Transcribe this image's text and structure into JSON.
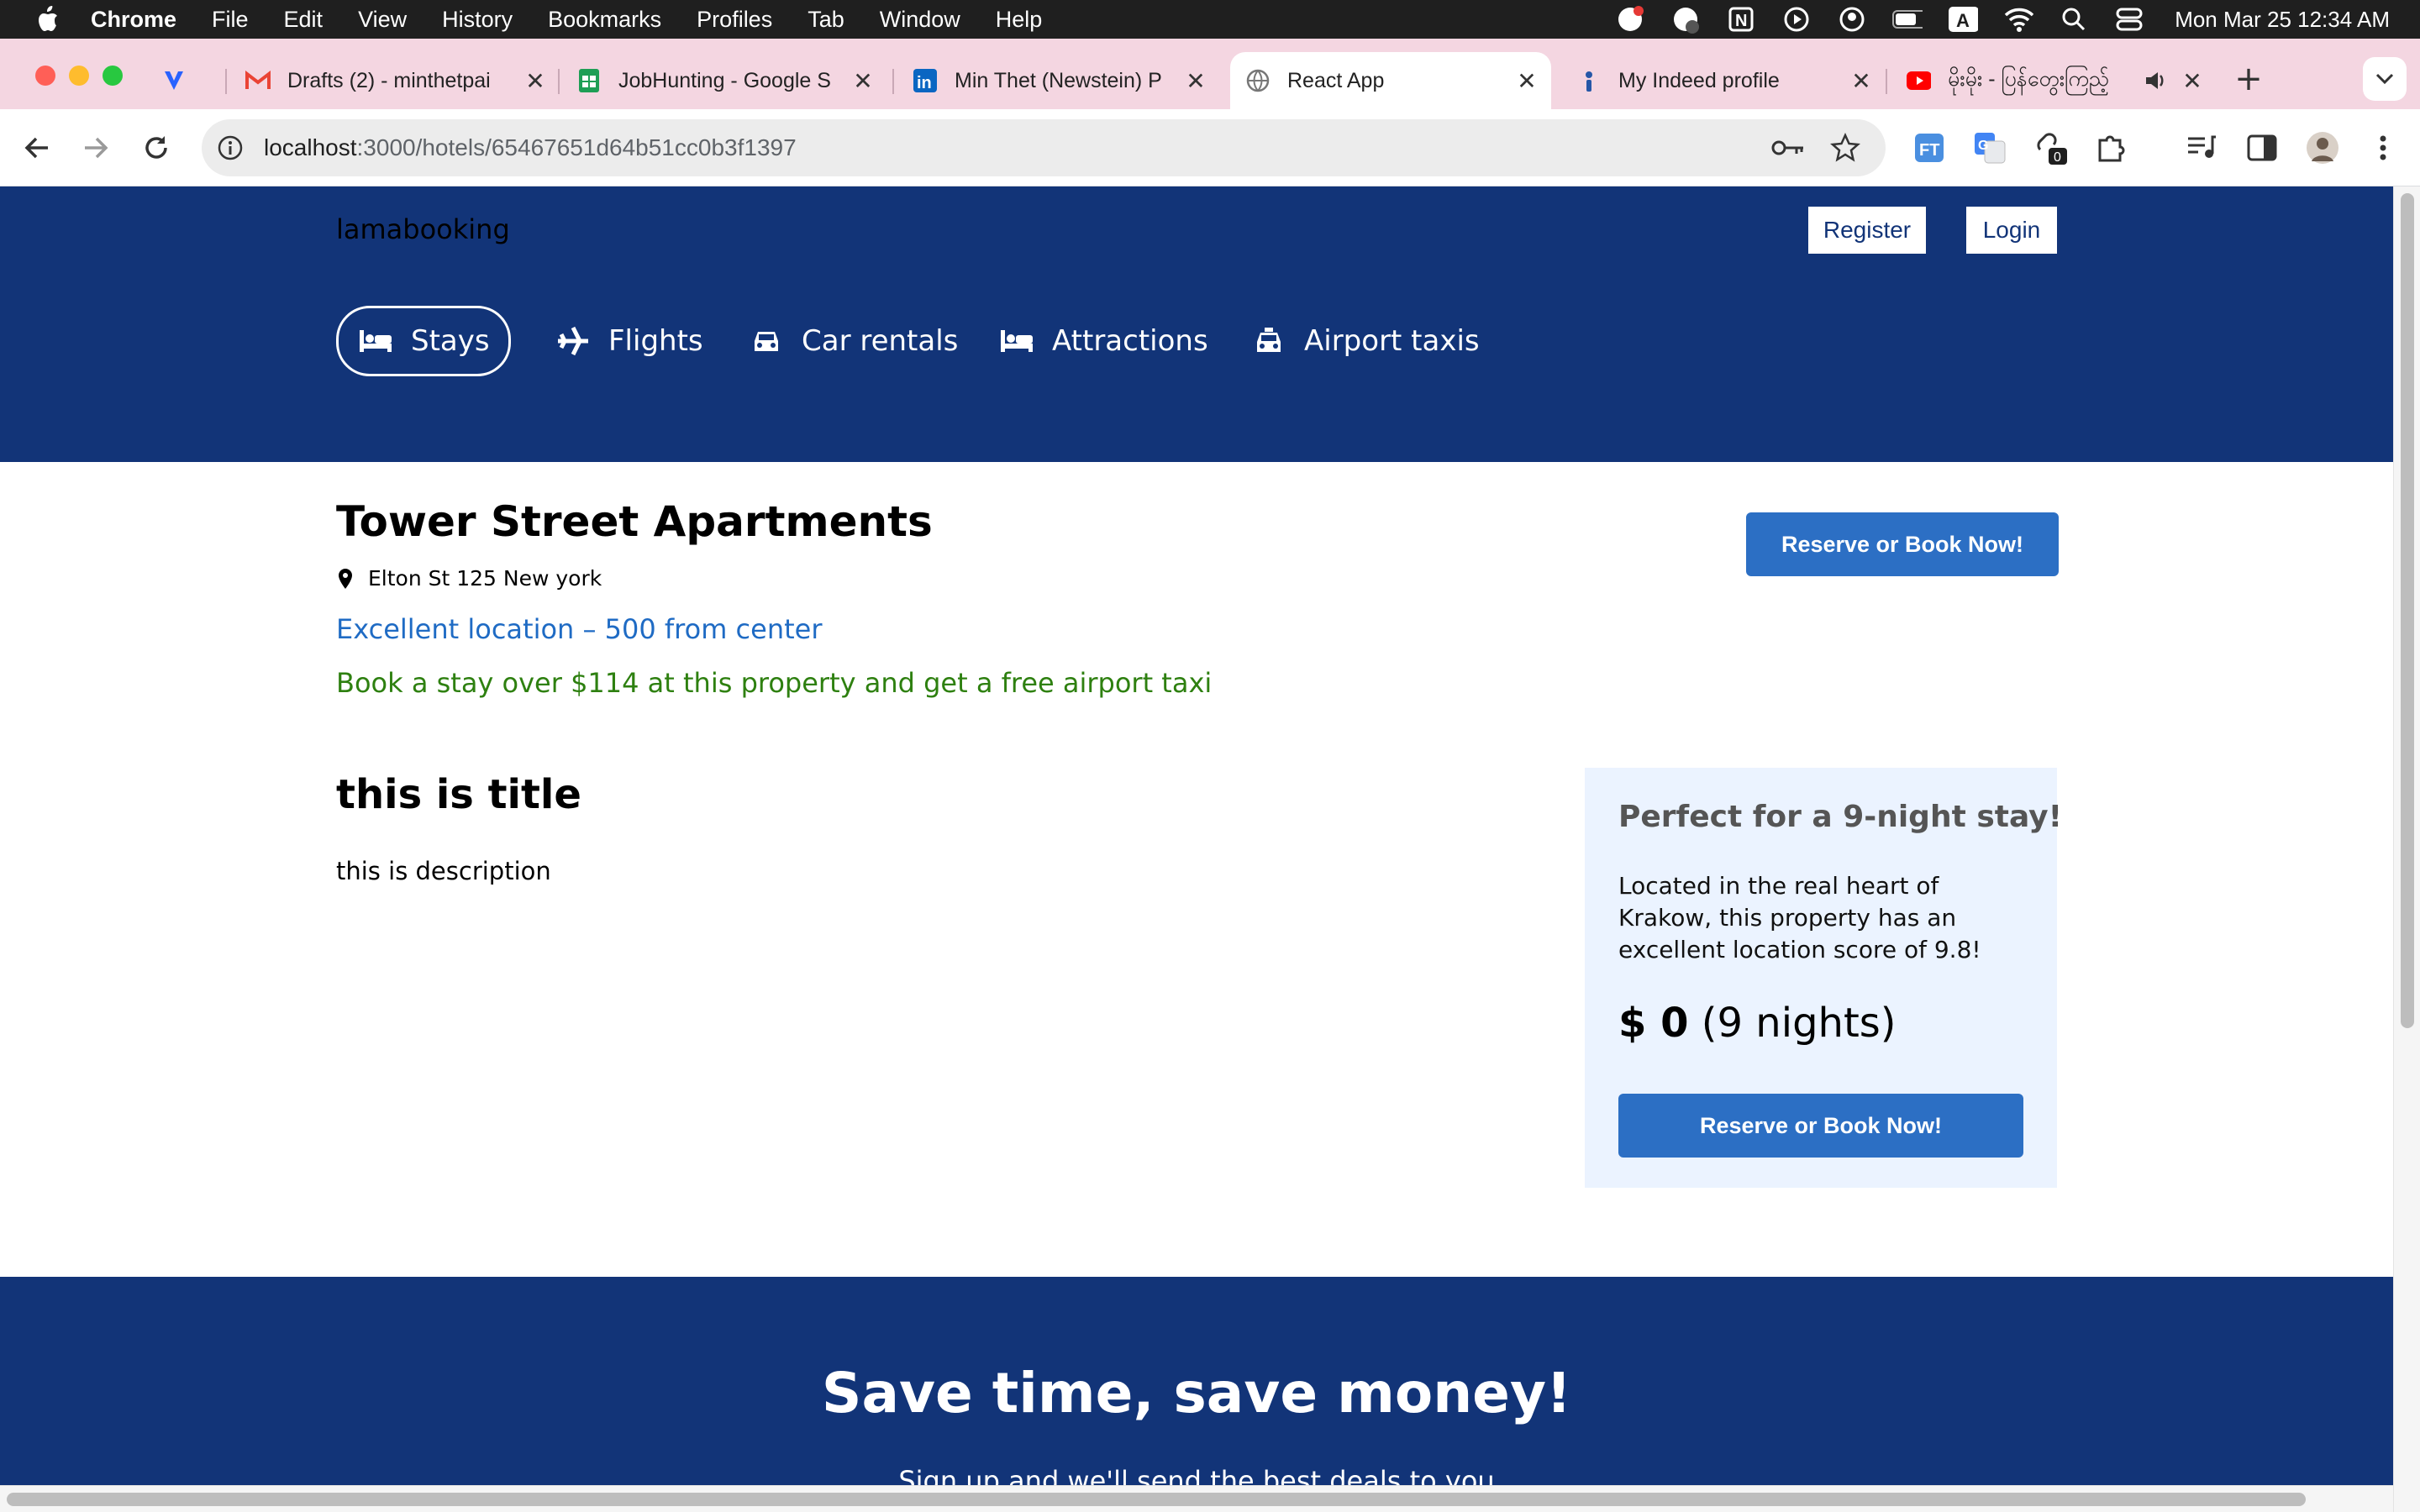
{
  "os_menubar": {
    "app_name": "Chrome",
    "menus": [
      "File",
      "Edit",
      "View",
      "History",
      "Bookmarks",
      "Profiles",
      "Tab",
      "Window",
      "Help"
    ],
    "clock": "Mon Mar 25  12:34 AM"
  },
  "browser": {
    "tabs": [
      {
        "title": "",
        "icon": "vercel-icon"
      },
      {
        "title": "Drafts (2) - minthetpai",
        "icon": "gmail-icon"
      },
      {
        "title": "JobHunting - Google S",
        "icon": "sheets-icon"
      },
      {
        "title": "Min Thet (Newstein) P",
        "icon": "linkedin-icon"
      },
      {
        "title": "React App",
        "icon": "globe-icon",
        "active": true
      },
      {
        "title": "My Indeed profile",
        "icon": "indeed-icon"
      },
      {
        "title": "မိုးမိုး - ပြန်တွေးကြည့်",
        "icon": "youtube-icon"
      }
    ],
    "url_host": "localhost",
    "url_path": ":3000/hotels/65467651d64b51cc0b3f1397",
    "extension_badge": "0",
    "ext_label": "FT"
  },
  "site": {
    "logo": "lamabooking",
    "register_label": "Register",
    "login_label": "Login",
    "nav": [
      {
        "label": "Stays",
        "icon": "bed-icon",
        "active": true
      },
      {
        "label": "Flights",
        "icon": "plane-icon"
      },
      {
        "label": "Car rentals",
        "icon": "car-icon"
      },
      {
        "label": "Attractions",
        "icon": "bed-icon"
      },
      {
        "label": "Airport taxis",
        "icon": "taxi-icon"
      }
    ]
  },
  "hotel": {
    "name": "Tower Street Apartments",
    "address": "Elton St 125 New york",
    "distance": "Excellent location – 500 from center",
    "promo": "Book a stay over $114 at this property and get a free airport taxi",
    "book_label": "Reserve or Book Now!",
    "title": "this is title",
    "description": "this is description"
  },
  "sidebar": {
    "title": "Perfect for a 9-night stay!",
    "description": "Located in the real heart of Krakow, this property has an excellent location score of 9.8!",
    "price": "$ 0",
    "nights": "(9 nights)",
    "book_label": "Reserve or Book Now!"
  },
  "mail_list": {
    "title": "Save time, save money!",
    "subtitle": "Sign up and we'll send the best deals to you"
  },
  "colors": {
    "header_bg": "#123478",
    "button_blue": "#2c6fc4",
    "distance_blue": "#1f6bc4",
    "promo_green": "#2e8010",
    "sidebar_bg": "#ebf3ff",
    "tabstrip_bg": "#f4d6e1"
  }
}
